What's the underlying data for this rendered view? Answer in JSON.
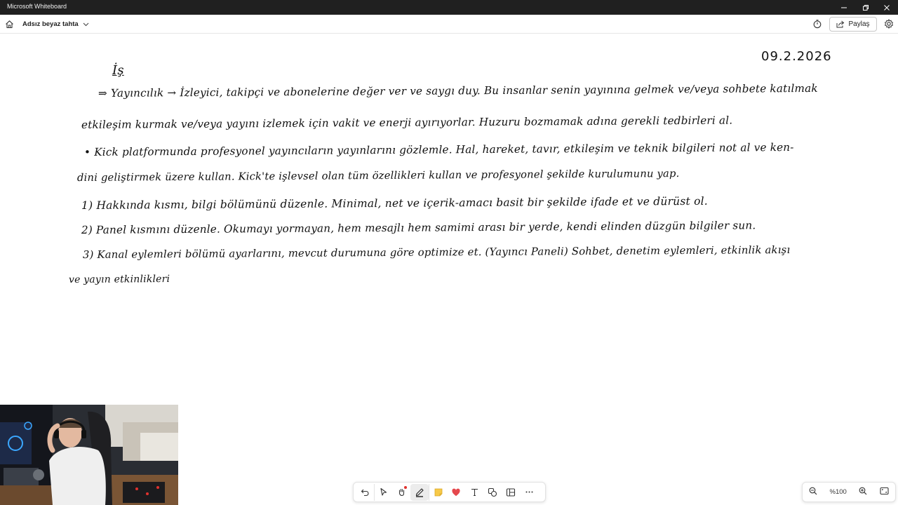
{
  "window": {
    "title": "Microsoft Whiteboard"
  },
  "toolbar": {
    "board_title": "Adsız beyaz tahta",
    "share_label": "Paylaş"
  },
  "canvas": {
    "date": "09.2.2026",
    "lines": [
      "İş",
      "⇒ Yayıncılık → İzleyici, takipçi ve abonelerine değer ver ve saygı duy. Bu insanlar senin yayınına gelmek ve/veya sohbete katılmak",
      "etkileşim kurmak ve/veya yayını izlemek için vakit ve enerji ayırıyorlar. Huzuru bozmamak adına gerekli tedbirleri al.",
      "• Kick platformunda profesyonel yayıncıların yayınlarını gözlemle. Hal, hareket, tavır, etkileşim ve teknik bilgileri not al ve ken-",
      "dini geliştirmek üzere kullan. Kick'te işlevsel olan tüm özellikleri kullan ve profesyonel şekilde kurulumunu yap.",
      "1) Hakkında kısmı, bilgi bölümünü düzenle. Minimal, net ve içerik-amacı basit bir şekilde ifade et ve dürüst ol.",
      "2) Panel kısmını düzenle. Okumayı yormayan, hem mesajlı hem samimi arası bir yerde, kendi elinden düzgün bilgiler sun.",
      "3) Kanal eylemleri bölümü ayarlarını, mevcut durumuna göre optimize et. (Yayıncı Paneli) Sohbet, denetim eylemleri, etkinlik akışı",
      "ve yayın etkinlikleri"
    ]
  },
  "bottom_toolbar": {
    "tools": [
      "undo-icon",
      "select-icon",
      "hand-icon",
      "pen-icon",
      "sticky-note-icon",
      "reaction-icon",
      "text-icon",
      "shapes-icon",
      "templates-icon",
      "more-icon"
    ]
  },
  "zoom": {
    "level": "%100"
  },
  "colors": {
    "titlebar": "#202020",
    "accent_recording": "#e0312d",
    "sticky": "#f7c948",
    "reaction": "#e5484d"
  }
}
